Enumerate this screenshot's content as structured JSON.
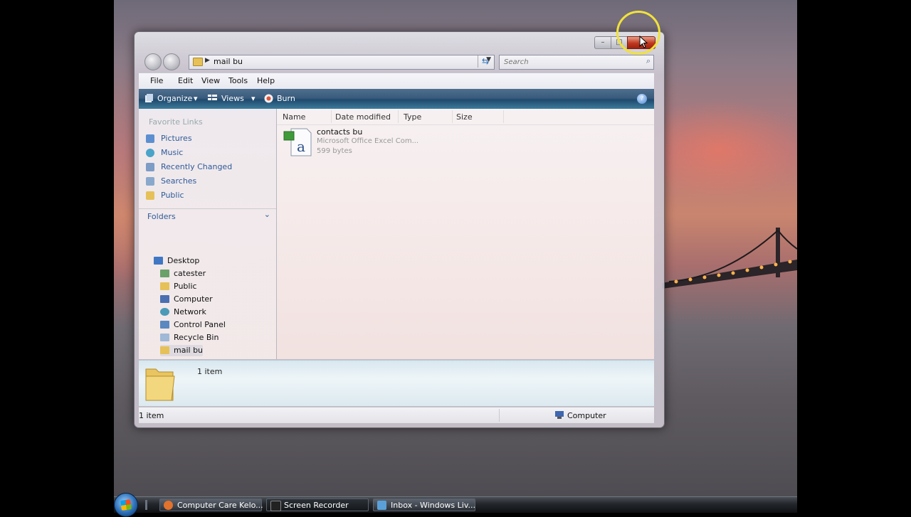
{
  "window": {
    "address": {
      "path": "mail bu"
    },
    "search": {
      "placeholder": "Search"
    },
    "menu": [
      "File",
      "Edit",
      "View",
      "Tools",
      "Help"
    ],
    "commands": {
      "organize": "Organize",
      "views": "Views",
      "burn": "Burn"
    },
    "favorites": {
      "heading": "Favorite Links",
      "items": [
        "Pictures",
        "Music",
        "Recently Changed",
        "Searches",
        "Public"
      ]
    },
    "folders": {
      "heading": "Folders",
      "items": [
        "Desktop",
        "catester",
        "Public",
        "Computer",
        "Network",
        "Control Panel",
        "Recycle Bin",
        "mail bu"
      ]
    },
    "columns": [
      "Name",
      "Date modified",
      "Type",
      "Size"
    ],
    "file": {
      "name": "contacts bu",
      "type": "Microsoft Office Excel Com...",
      "size": "599 bytes"
    },
    "details": {
      "count": "1 item"
    },
    "status": {
      "left": "1 item",
      "right": "Computer"
    }
  },
  "taskbar": {
    "tasks": [
      "Computer Care Kelo...",
      "Screen Recorder",
      "Inbox - Windows Liv..."
    ]
  },
  "colors": {
    "link": "#2e5b9a",
    "highlight": "#f1e23a",
    "close_button": "#c0371d"
  }
}
